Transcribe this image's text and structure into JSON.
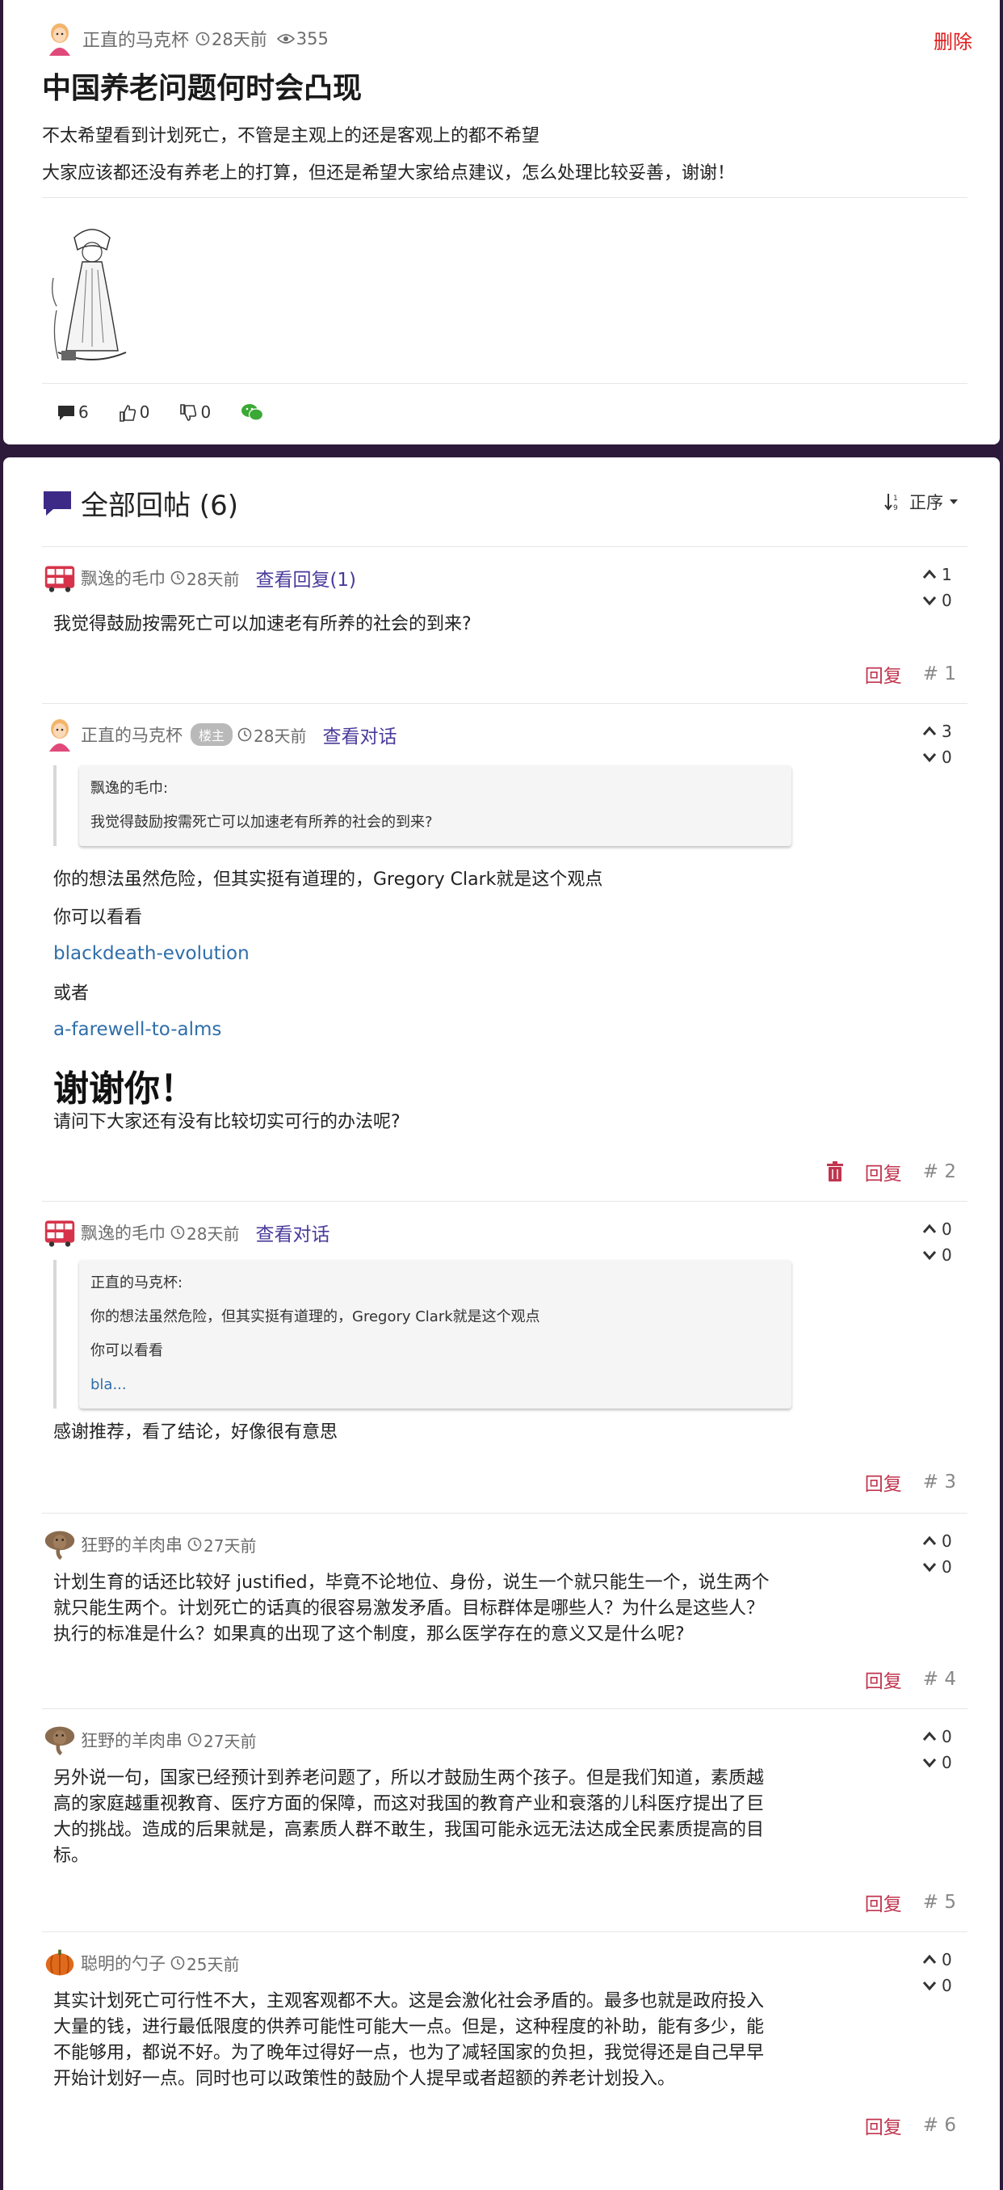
{
  "post": {
    "author": "正直的马克杯",
    "time": "28天前",
    "views": "355",
    "delete_label": "删除",
    "title": "中国养老问题何时会凸现",
    "body": [
      "不太希望看到计划死亡，不管是主观上的还是客观上的都不希望",
      "大家应该都还没有养老上的打算，但还是希望大家给点建议，怎么处理比较妥善，谢谢！"
    ],
    "actions": {
      "comments": "6",
      "likes": "0",
      "dislikes": "0"
    }
  },
  "replies_section": {
    "title": "全部回帖 (6)",
    "sort_label": "正序"
  },
  "replies": [
    {
      "author": "飘逸的毛巾",
      "time": "28天前",
      "view_label": "查看回复(1)",
      "up": "1",
      "down": "0",
      "body": "我觉得鼓励按需死亡可以加速老有所养的社会的到来?",
      "reply_label": "回复",
      "floor": "# 1"
    },
    {
      "author": "正直的马克杯",
      "badge": "楼主",
      "time": "28天前",
      "view_label": "查看对话",
      "up": "3",
      "down": "0",
      "quote_author": "飘逸的毛巾:",
      "quote_text": "我觉得鼓励按需死亡可以加速老有所养的社会的到来?",
      "lines": [
        "你的想法虽然危险，但其实挺有道理的，Gregory Clark就是这个观点",
        "你可以看看"
      ],
      "link1": "blackdeath-evolution",
      "or": "或者",
      "link2": "a-farewell-to-alms",
      "big": "谢谢你！",
      "last": "请问下大家还有没有比较切实可行的办法呢?",
      "reply_label": "回复",
      "floor": "# 2"
    },
    {
      "author": "飘逸的毛巾",
      "time": "28天前",
      "view_label": "查看对话",
      "up": "0",
      "down": "0",
      "quote_author": "正直的马克杯:",
      "quote_lines": [
        "你的想法虽然危险，但其实挺有道理的，Gregory Clark就是这个观点",
        "你可以看看"
      ],
      "quote_link": "bla...",
      "body": "感谢推荐，看了结论，好像很有意思",
      "reply_label": "回复",
      "floor": "# 3"
    },
    {
      "author": "狂野的羊肉串",
      "time": "27天前",
      "up": "0",
      "down": "0",
      "body_lines": [
        "计划生育的话还比较好 justified，毕竟不论地位、身份，说生一个就只能生一个，说生两个",
        "就只能生两个。计划死亡的话真的很容易激发矛盾。目标群体是哪些人？为什么是这些人？",
        "执行的标准是什么？如果真的出现了这个制度，那么医学存在的意义又是什么呢?"
      ],
      "reply_label": "回复",
      "floor": "# 4"
    },
    {
      "author": "狂野的羊肉串",
      "time": "27天前",
      "up": "0",
      "down": "0",
      "body_lines": [
        "另外说一句，国家已经预计到养老问题了，所以才鼓励生两个孩子。但是我们知道，素质越",
        "高的家庭越重视教育、医疗方面的保障，而这对我国的教育产业和衰落的儿科医疗提出了巨",
        "大的挑战。造成的后果就是，高素质人群不敢生，我国可能永远无法达成全民素质提高的目",
        "标。"
      ],
      "reply_label": "回复",
      "floor": "# 5"
    },
    {
      "author": "聪明的勺子",
      "time": "25天前",
      "up": "0",
      "down": "0",
      "body_lines": [
        "其实计划死亡可行性不大，主观客观都不大。这是会激化社会矛盾的。最多也就是政府投入",
        "大量的钱，进行最低限度的供养可能性可能大一点。但是，这种程度的补助，能有多少，能",
        "不能够用，都说不好。为了晚年过得好一点，也为了减轻国家的负担，我觉得还是自己早早",
        "开始计划好一点。同时也可以政策性的鼓励个人提早或者超额的养老计划投入。"
      ],
      "reply_label": "回复",
      "floor": "# 6"
    }
  ],
  "colors": {
    "delete": "#e01b1b",
    "reply": "#c0354f",
    "link": "#2f6eaa",
    "view": "#4a3a9a",
    "accent": "#3d2a86"
  }
}
